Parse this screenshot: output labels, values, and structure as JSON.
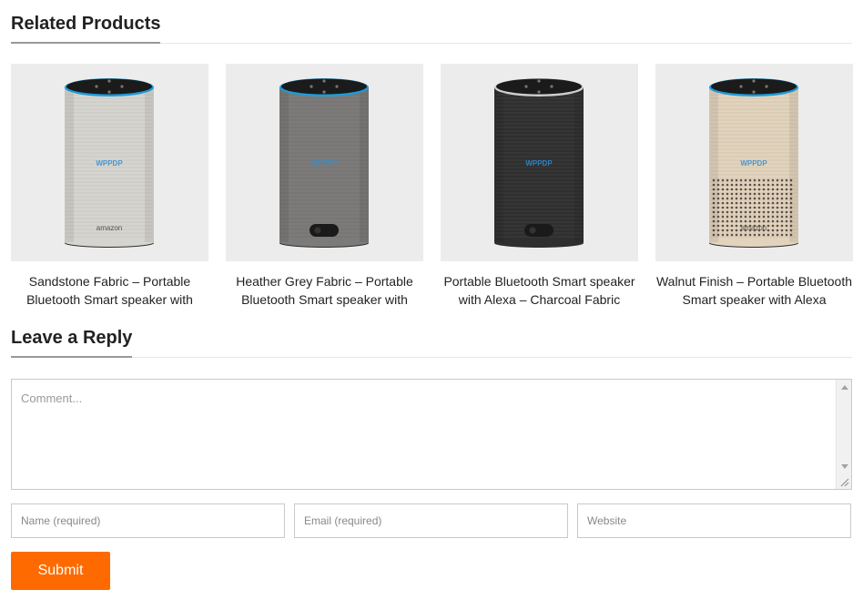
{
  "related": {
    "heading": "Related Products",
    "products": [
      {
        "title": "Sandstone Fabric – Portable Bluetooth Smart speaker with",
        "finish": "sandstone",
        "body_color": "#d6d4cf",
        "logo_text": "amazon",
        "image_caption": "WPPDP"
      },
      {
        "title": "Heather Grey Fabric – Portable Bluetooth Smart speaker with",
        "finish": "heather-grey",
        "body_color": "#7c7b79",
        "logo_text": "",
        "image_caption": "WPPDP"
      },
      {
        "title": "Portable Bluetooth Smart speaker with Alexa – Charcoal Fabric",
        "finish": "charcoal",
        "body_color": "#2f2f2f",
        "logo_text": "",
        "image_caption": "WPPDP"
      },
      {
        "title": "Walnut Finish – Portable Bluetooth Smart speaker with Alexa",
        "finish": "walnut",
        "body_color": "#e2d3bd",
        "logo_text": "amazon",
        "image_caption": "WPPDP"
      }
    ]
  },
  "reply": {
    "heading": "Leave a Reply",
    "comment_placeholder": "Comment...",
    "name_placeholder": "Name (required)",
    "email_placeholder": "Email (required)",
    "website_placeholder": "Website",
    "submit_label": "Submit"
  },
  "colors": {
    "accent": "#ff6a00",
    "light_ring": "#1e9bd7",
    "heading_underline": "#999999"
  }
}
